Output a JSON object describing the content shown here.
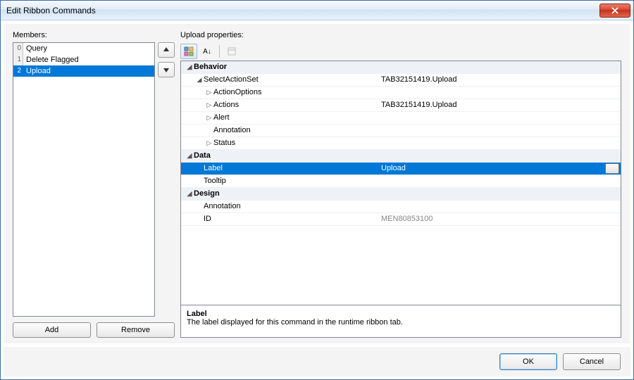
{
  "window": {
    "title": "Edit Ribbon Commands"
  },
  "labels": {
    "members": "Members:",
    "properties": "Upload properties:"
  },
  "members": [
    {
      "index": "0",
      "name": "Query"
    },
    {
      "index": "1",
      "name": "Delete Flagged"
    },
    {
      "index": "2",
      "name": "Upload"
    }
  ],
  "selectedMember": 2,
  "buttons": {
    "add": "Add",
    "remove": "Remove",
    "ok": "OK",
    "cancel": "Cancel"
  },
  "propGrid": {
    "categories": [
      {
        "name": "Behavior",
        "rows": [
          {
            "name": "SelectActionSet",
            "value": "TAB32151419.Upload",
            "expandable": true,
            "expanded": true,
            "indent": 0,
            "children": [
              {
                "name": "ActionOptions",
                "value": "",
                "expandable": true,
                "expanded": false
              },
              {
                "name": "Actions",
                "value": "TAB32151419.Upload",
                "expandable": true,
                "expanded": false
              },
              {
                "name": "Alert",
                "value": "",
                "expandable": true,
                "expanded": false
              },
              {
                "name": "Annotation",
                "value": "",
                "expandable": false
              },
              {
                "name": "Status",
                "value": "",
                "expandable": true,
                "expanded": false
              }
            ]
          }
        ]
      },
      {
        "name": "Data",
        "rows": [
          {
            "name": "Label",
            "value": "Upload",
            "selected": true,
            "hasEllipsis": true,
            "indent": 0
          },
          {
            "name": "Tooltip",
            "value": "",
            "indent": 0
          }
        ]
      },
      {
        "name": "Design",
        "rows": [
          {
            "name": "Annotation",
            "value": "",
            "indent": 0
          },
          {
            "name": "ID",
            "value": "MEN80853100",
            "indent": 0,
            "dim": true
          }
        ]
      }
    ]
  },
  "description": {
    "title": "Label",
    "text": "The label displayed for this command in the runtime ribbon tab."
  }
}
